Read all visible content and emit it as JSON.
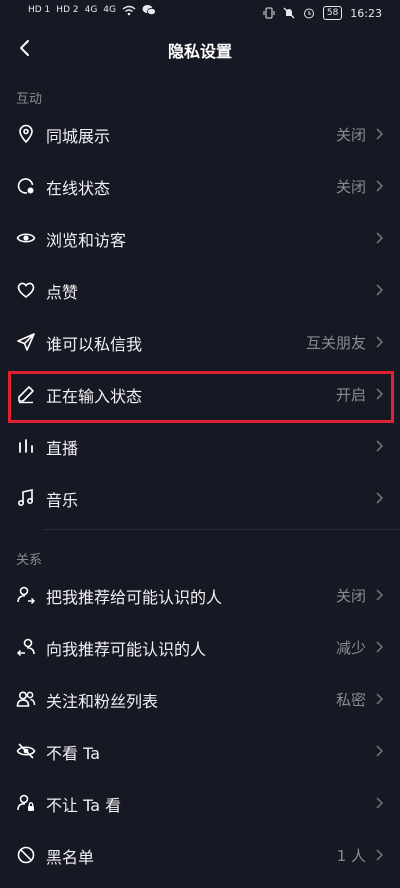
{
  "status": {
    "time": "16:23",
    "battery": "58",
    "left_labels": [
      "HD 1",
      "HD 2",
      "4G",
      "4G"
    ]
  },
  "header": {
    "title": "隐私设置"
  },
  "sections": [
    {
      "title": "互动",
      "items": [
        {
          "label": "同城展示",
          "value": "关闭",
          "icon": "location-pin-icon"
        },
        {
          "label": "在线状态",
          "value": "关闭",
          "icon": "online-status-icon"
        },
        {
          "label": "浏览和访客",
          "value": "",
          "icon": "eye-icon"
        },
        {
          "label": "点赞",
          "value": "",
          "icon": "heart-icon"
        },
        {
          "label": "谁可以私信我",
          "value": "互关朋友",
          "icon": "send-icon"
        },
        {
          "label": "正在输入状态",
          "value": "开启",
          "icon": "pencil-icon"
        },
        {
          "label": "直播",
          "value": "",
          "icon": "bars-icon"
        },
        {
          "label": "音乐",
          "value": "",
          "icon": "music-note-icon"
        }
      ]
    },
    {
      "title": "关系",
      "items": [
        {
          "label": "把我推荐给可能认识的人",
          "value": "关闭",
          "icon": "user-share-icon"
        },
        {
          "label": "向我推荐可能认识的人",
          "value": "减少",
          "icon": "user-recommend-icon"
        },
        {
          "label": "关注和粉丝列表",
          "value": "私密",
          "icon": "users-icon"
        },
        {
          "label": "不看 Ta",
          "value": "",
          "icon": "eye-off-icon"
        },
        {
          "label": "不让 Ta 看",
          "value": "",
          "icon": "user-lock-icon"
        },
        {
          "label": "黑名单",
          "value": "1 人",
          "icon": "block-icon"
        }
      ]
    }
  ]
}
